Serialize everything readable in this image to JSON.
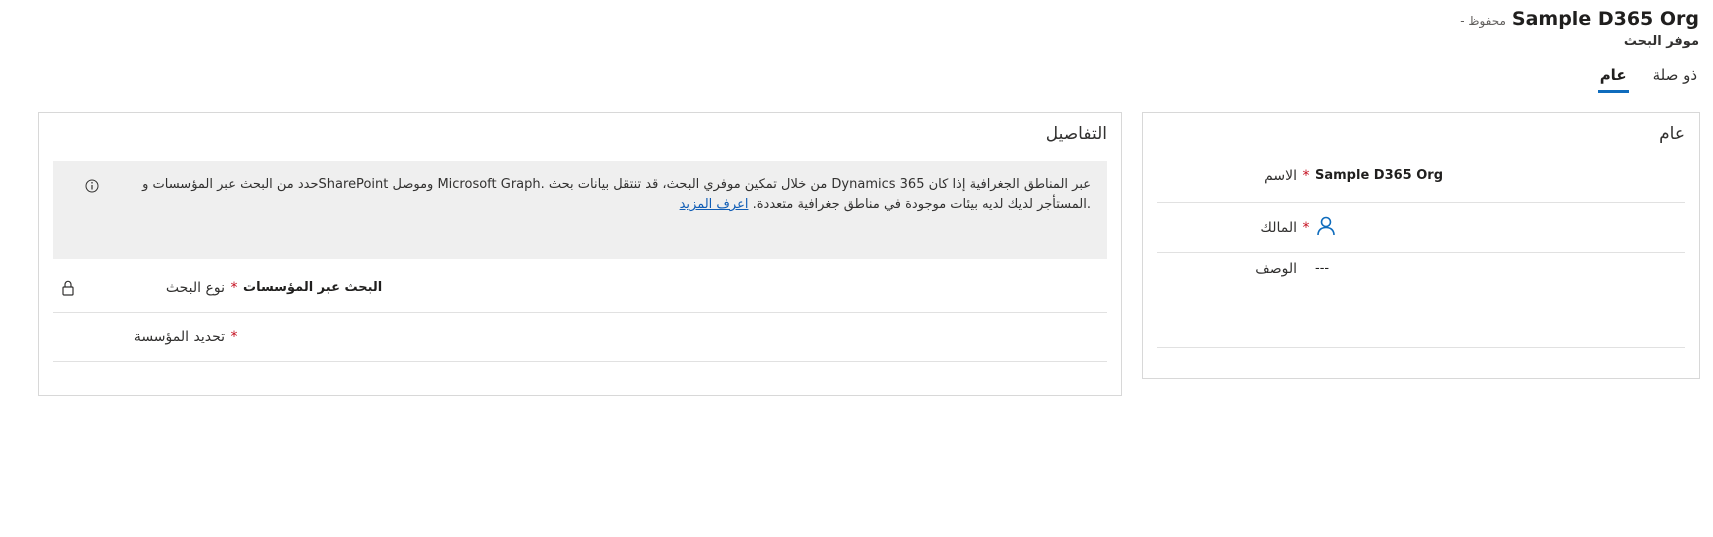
{
  "header": {
    "record_title": "Sample D365 Org",
    "saved_state": "- محفوظ",
    "entity_name": "موفر البحث"
  },
  "tabs": [
    {
      "label": "عام",
      "active": true
    },
    {
      "label": "ذو صلة",
      "active": false
    }
  ],
  "general_section": {
    "title": "عام",
    "fields": {
      "name": {
        "label": "الاسم",
        "required": "*",
        "value": "Sample D365 Org"
      },
      "owner": {
        "label": "المالك",
        "required": "*",
        "value_icon": "person-icon"
      },
      "description": {
        "label": "الوصف",
        "value": "---"
      }
    }
  },
  "details_section": {
    "title": "التفاصيل",
    "notice": {
      "line1": "عبر المناطق الجغرافية إذا كان Dynamics 365 من خلال تمكين موفري البحث، قد تنتقل بيانات بحث .Microsoft Graph وموصل SharePointحدد من البحث عبر المؤسسات و",
      "line2": ".المستأجر لديك لديه بيئات موجودة في مناطق جغرافية متعددة.",
      "link": "اعرف المزيد",
      "icon": "info-icon"
    },
    "fields": {
      "search_type": {
        "label": "نوع البحث",
        "required": "*",
        "value": "البحث عبر المؤسسات",
        "icon": "lock-icon"
      },
      "organization": {
        "label": "تحديد المؤسسة",
        "required": "*",
        "value": ""
      }
    }
  },
  "colors": {
    "accent": "#0f6cbd",
    "required": "#c50f1f",
    "link": "#0f5db6",
    "notice_bg": "#efefef"
  }
}
